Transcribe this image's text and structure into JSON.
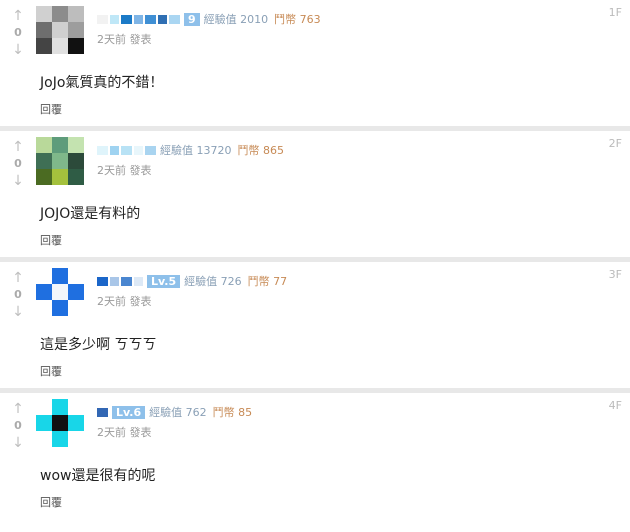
{
  "posts": [
    {
      "floor": "1F",
      "score": "0",
      "level": "9",
      "exp_label": "經驗值 2010",
      "coin_label": "鬥幣 763",
      "time": "2天前",
      "published": "發表",
      "content": "JoJo氣質真的不錯！",
      "reply": "回覆",
      "avatar_colors": [
        "#d0d0d0",
        "#8c8c8c",
        "#bdbdbd",
        "#6e6e6e",
        "#cfcfcf",
        "#9d9d9d",
        "#444444",
        "#e0e0e0",
        "#111111"
      ],
      "name_colors": [
        "#f2f2f2",
        "#bfe7f7",
        "#1b7ac7",
        "#7fb5e6",
        "#3f8fd4",
        "#2f6fb3",
        "#aad6f2"
      ]
    },
    {
      "floor": "2F",
      "score": "0",
      "level": "",
      "exp_label": "經驗值 13720",
      "coin_label": "鬥幣 865",
      "time": "2天前",
      "published": "發表",
      "content": "JOJO還是有料的",
      "reply": "回覆",
      "avatar_colors": [
        "#b9d99a",
        "#5e9c7b",
        "#c4e3b0",
        "#3f6f55",
        "#7fb88a",
        "#2c4a3a",
        "#4b6b22",
        "#a4c13d",
        "#2f5c45"
      ],
      "name_colors": [
        "#dff4fb",
        "#9fd3f1",
        "#b8e2f5",
        "#e8f6fb",
        "#a9d4f0"
      ]
    },
    {
      "floor": "3F",
      "score": "0",
      "level": "Lv.5",
      "exp_label": "經驗值 726",
      "coin_label": "鬥幣 77",
      "time": "2天前",
      "published": "發表",
      "content": "這是多少啊 ㄎㄎㄎ",
      "reply": "回覆",
      "avatar_colors": [
        "#ffffff",
        "#1f6fe0",
        "#ffffff",
        "#1f6fe0",
        "#f2f6fb",
        "#1f6fe0",
        "#ffffff",
        "#1f6fe0",
        "#ffffff"
      ],
      "name_colors": [
        "#1b66c9",
        "#a9c6e8",
        "#4a86d0",
        "#dde9f6"
      ]
    },
    {
      "floor": "4F",
      "score": "0",
      "level": "Lv.6",
      "exp_label": "經驗值 762",
      "coin_label": "鬥幣 85",
      "time": "2天前",
      "published": "發表",
      "content": "wow還是很有的呢",
      "reply": "回覆",
      "avatar_colors": [
        "#ffffff",
        "#18d6e8",
        "#ffffff",
        "#18d6e8",
        "#111111",
        "#18d6e8",
        "#ffffff",
        "#18d6e8",
        "#ffffff"
      ],
      "name_colors": [
        "#3267b4"
      ]
    }
  ]
}
